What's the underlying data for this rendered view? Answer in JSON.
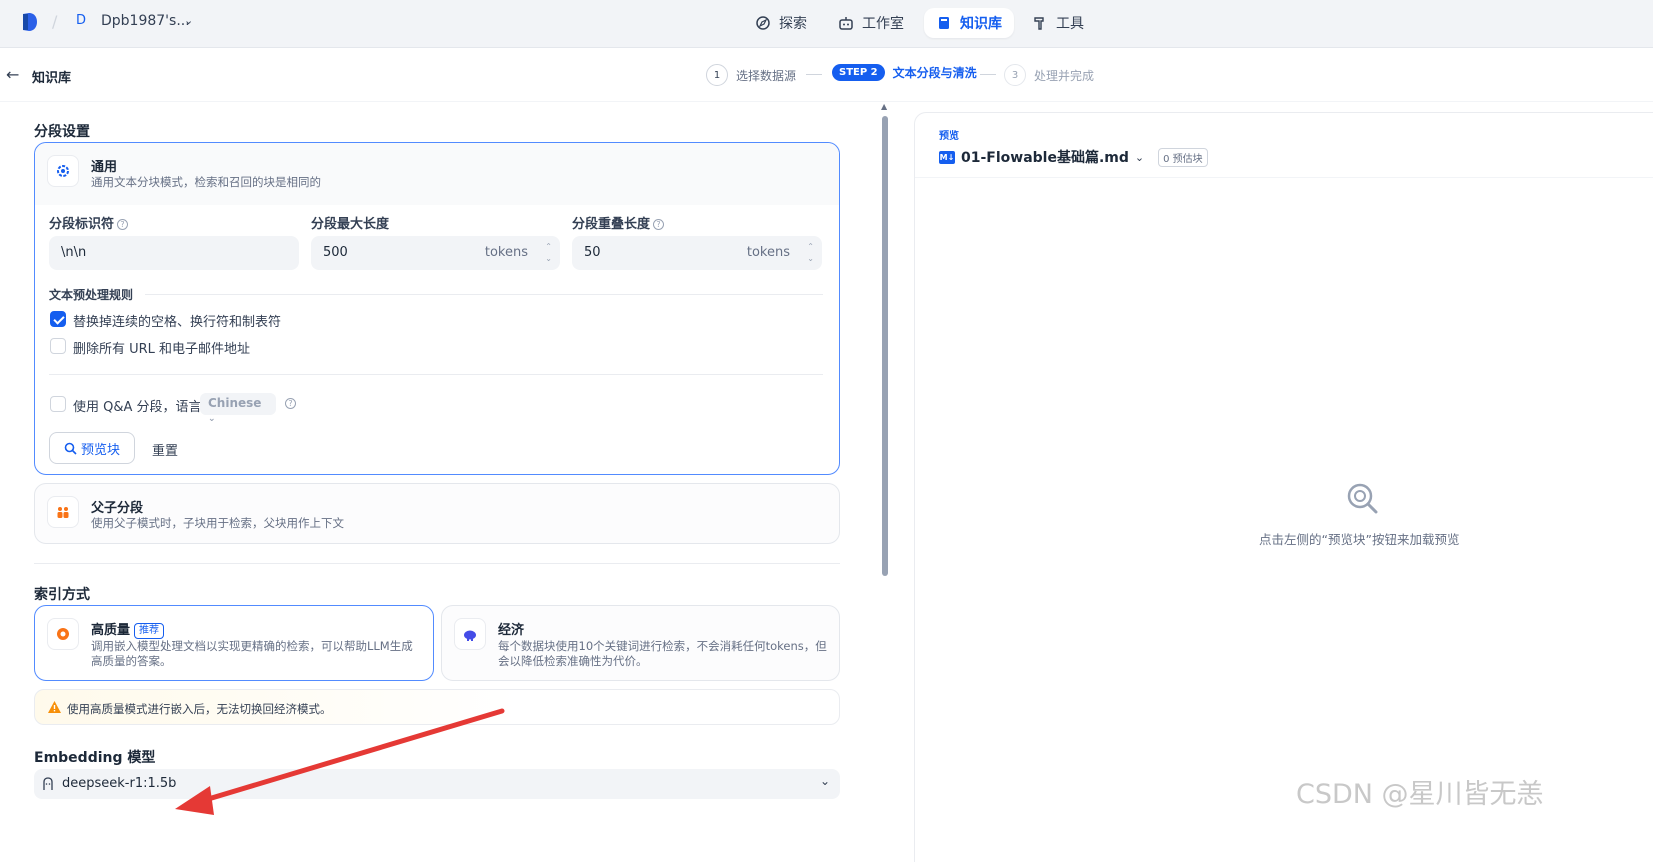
{
  "workspace": {
    "initial": "D",
    "name": "Dpb1987's..."
  },
  "nav": {
    "explore": "探索",
    "studio": "工作室",
    "knowledge": "知识库",
    "tools": "工具"
  },
  "header": {
    "back_title": "知识库",
    "steps": [
      {
        "num": "1",
        "label": "选择数据源"
      },
      {
        "num": "STEP 2",
        "label": "文本分段与清洗"
      },
      {
        "num": "3",
        "label": "处理并完成"
      }
    ]
  },
  "segment": {
    "section_title": "分段设置",
    "general": {
      "title": "通用",
      "desc": "通用文本分块模式，检索和召回的块是相同的"
    },
    "delimiter_label": "分段标识符",
    "delimiter_value": "\\n\\n",
    "max_len_label": "分段最大长度",
    "max_len_value": "500",
    "overlap_label": "分段重叠长度",
    "overlap_value": "50",
    "unit": "tokens",
    "preprocess_title": "文本预处理规则",
    "rule1": "替换掉连续的空格、换行符和制表符",
    "rule2": "删除所有 URL 和电子邮件地址",
    "qa_label": "使用 Q&A 分段，语言",
    "qa_lang": "Chinese",
    "preview_btn": "预览块",
    "reset_btn": "重置",
    "parent_child": {
      "title": "父子分段",
      "desc": "使用父子模式时，子块用于检索，父块用作上下文"
    }
  },
  "index": {
    "section_title": "索引方式",
    "high": {
      "title": "高质量",
      "badge": "推荐",
      "desc1": "调用嵌入模型处理文档以实现更精确的检索，可以帮助LLM生成",
      "desc2": "高质量的答案。"
    },
    "economy": {
      "title": "经济",
      "desc1": "每个数据块使用10个关键词进行检索，不会消耗任何tokens，但",
      "desc2": "会以降低检索准确性为代价。"
    },
    "warning": "使用高质量模式进行嵌入后，无法切换回经济模式。"
  },
  "embedding": {
    "section_title": "Embedding 模型",
    "model": "deepseek-r1:1.5b"
  },
  "preview": {
    "label": "预览",
    "doc_name": "01-Flowable基础篇.md",
    "chunk_count": "0 预估块",
    "empty_hint": "点击左侧的“预览块”按钮来加载预览"
  },
  "watermark": "CSDN @星川皆无恙",
  "colors": {
    "accent": "#155eef",
    "warning": "#f79009",
    "arrow": "#e53935"
  }
}
